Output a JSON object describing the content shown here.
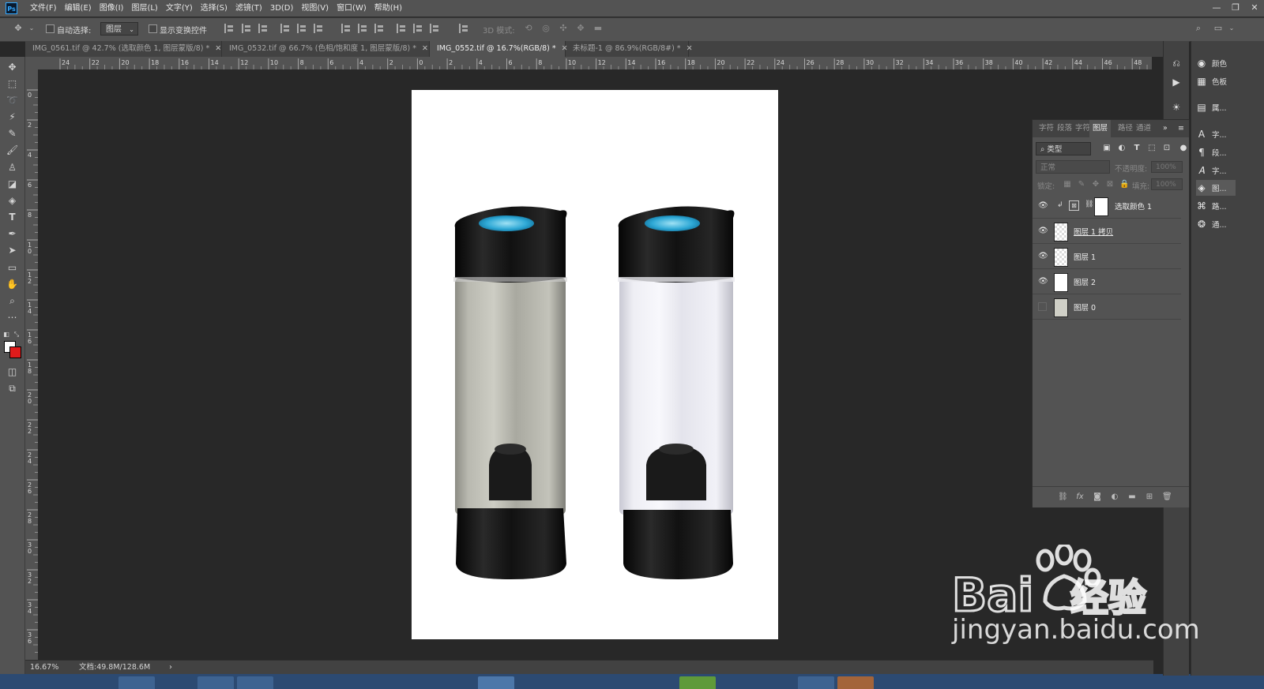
{
  "app": {
    "logo_text": "Ps",
    "menu": [
      "文件(F)",
      "编辑(E)",
      "图像(I)",
      "图层(L)",
      "文字(Y)",
      "选择(S)",
      "滤镜(T)",
      "3D(D)",
      "视图(V)",
      "窗口(W)",
      "帮助(H)"
    ],
    "window_controls": [
      "—",
      "❐",
      "✕"
    ]
  },
  "options_bar": {
    "auto_select_label": "自动选择:",
    "auto_select_value": "图层",
    "show_transform_label": "显示变换控件",
    "mode_3d_label": "3D 模式:"
  },
  "tabs": [
    {
      "label": "IMG_0561.tif @ 42.7% (选取颜色 1, 图层蒙版/8) *",
      "active": false
    },
    {
      "label": "IMG_0532.tif @ 66.7% (色相/饱和度 1, 图层蒙版/8) *",
      "active": false
    },
    {
      "label": "IMG_0552.tif @ 16.7%(RGB/8) *",
      "active": true
    },
    {
      "label": "未标题-1 @ 86.9%(RGB/8#) *",
      "active": false
    }
  ],
  "ruler": {
    "top_labels": [
      "24",
      "22",
      "20",
      "18",
      "16",
      "14",
      "12",
      "10",
      "8",
      "6",
      "4",
      "2",
      "0",
      "2",
      "4",
      "6",
      "8",
      "10",
      "12",
      "14",
      "16",
      "18",
      "20",
      "22",
      "24",
      "26",
      "28",
      "30",
      "32",
      "34",
      "36",
      "38",
      "40",
      "42",
      "44",
      "46",
      "48"
    ],
    "left_labels": [
      "0",
      "2",
      "4",
      "6",
      "8",
      "10",
      "12",
      "14",
      "16",
      "18",
      "20",
      "22",
      "24",
      "26",
      "28",
      "30",
      "32",
      "34",
      "36"
    ]
  },
  "tools": [
    "move-tool",
    "marquee-tool",
    "lasso-tool",
    "magic-wand-tool",
    "eyedropper-tool",
    "brush-tool",
    "stamp-tool",
    "eraser-tool",
    "paint-bucket-tool",
    "type-tool",
    "pen-tool",
    "path-select-tool",
    "rectangle-tool",
    "hand-tool",
    "zoom-tool",
    "more-tools"
  ],
  "colors": {
    "foreground": "#ffffff",
    "background": "#e01b1b"
  },
  "status": {
    "zoom": "16.67%",
    "doc_size": "文档:49.8M/128.6M"
  },
  "dock": {
    "group1": [
      {
        "icon": "color-icon",
        "label": "颜色"
      },
      {
        "icon": "swatches-icon",
        "label": "色板"
      }
    ],
    "group2": [
      {
        "icon": "properties-icon",
        "label": "属..."
      }
    ],
    "group3": [
      {
        "icon": "character-icon",
        "label": "字..."
      },
      {
        "icon": "paragraph-icon",
        "label": "段..."
      },
      {
        "icon": "character-style-icon",
        "label": "字..."
      },
      {
        "icon": "layers-icon",
        "label": "图..."
      },
      {
        "icon": "paths-icon",
        "label": "路..."
      },
      {
        "icon": "channels-icon",
        "label": "通..."
      }
    ]
  },
  "layers_panel": {
    "tabs": [
      "字符",
      "段落",
      "字符",
      "图层",
      "路径",
      "通道"
    ],
    "filter_label": "类型",
    "blend_mode": "正常",
    "opacity_label": "不透明度:",
    "opacity_value": "100%",
    "lock_label": "锁定:",
    "fill_label": "填充:",
    "fill_value": "100%",
    "layers": [
      {
        "name": "选取颜色 1",
        "visible": true,
        "type": "adjustment"
      },
      {
        "name": "图层 1 拷贝",
        "visible": true,
        "type": "pixel"
      },
      {
        "name": "图层 1",
        "visible": true,
        "type": "pixel"
      },
      {
        "name": "图层 2",
        "visible": true,
        "type": "fill"
      },
      {
        "name": "图层 0",
        "visible": false,
        "type": "pixel"
      }
    ]
  },
  "watermark": {
    "brand": "Bai",
    "brand_suffix": "经验",
    "url": "jingyan.baidu.com"
  }
}
